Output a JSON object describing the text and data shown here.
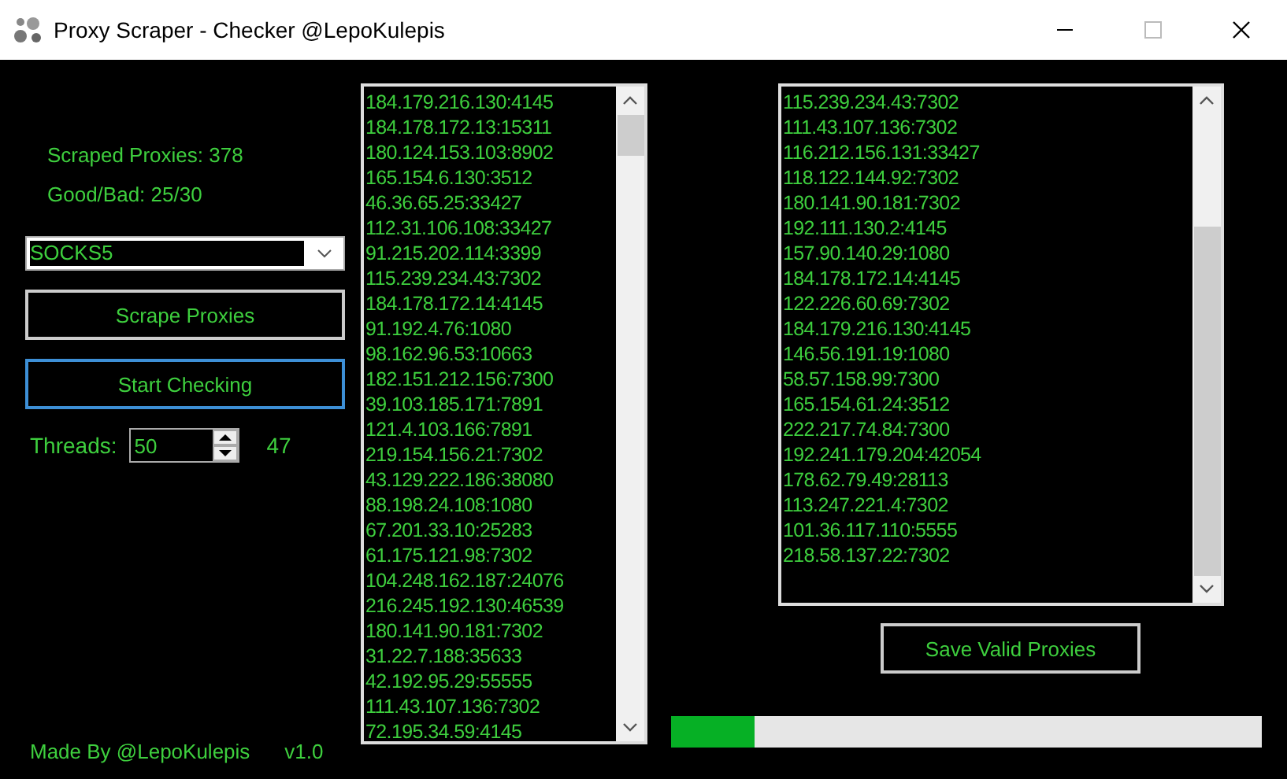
{
  "window": {
    "title": "Proxy Scraper - Checker @LepoKulepis"
  },
  "stats": [
    "Scraped Proxies: 378",
    "Good/Bad: 25/30"
  ],
  "proxy_type": {
    "value": "SOCKS5"
  },
  "buttons": [
    {
      "label": "Scrape Proxies",
      "focused": false
    },
    {
      "label": "Start Checking",
      "focused": true
    }
  ],
  "threads": {
    "label": "Threads:",
    "value": "50",
    "count": "47"
  },
  "scraped_list": [
    "184.179.216.130:4145",
    "184.178.172.13:15311",
    "180.124.153.103:8902",
    "165.154.6.130:3512",
    "46.36.65.25:33427",
    "112.31.106.108:33427",
    "91.215.202.114:3399",
    "115.239.234.43:7302",
    "184.178.172.14:4145",
    "91.192.4.76:1080",
    "98.162.96.53:10663",
    "182.151.212.156:7300",
    "39.103.185.171:7891",
    "121.4.103.166:7891",
    "219.154.156.21:7302",
    "43.129.222.186:38080",
    "88.198.24.108:1080",
    "67.201.33.10:25283",
    "61.175.121.98:7302",
    "104.248.162.187:24076",
    "216.245.192.130:46539",
    "180.141.90.181:7302",
    "31.22.7.188:35633",
    "42.192.95.29:55555",
    "111.43.107.136:7302",
    "72.195.34.59:4145"
  ],
  "valid_list": [
    "115.239.234.43:7302",
    "111.43.107.136:7302",
    "116.212.156.131:33427",
    "118.122.144.92:7302",
    "180.141.90.181:7302",
    "192.111.130.2:4145",
    "157.90.140.29:1080",
    "184.178.172.14:4145",
    "122.226.60.69:7302",
    "184.179.216.130:4145",
    "146.56.191.19:1080",
    "58.57.158.99:7300",
    "165.154.61.24:3512",
    "222.217.74.84:7300",
    "192.241.179.204:42054",
    "178.62.79.49:28113",
    "113.247.221.4:7302",
    "101.36.117.110:5555",
    "218.58.137.22:7302"
  ],
  "save_button": {
    "label": "Save Valid Proxies"
  },
  "progress": {
    "level": 0.14
  },
  "footer": {
    "credit": "Made By @LepoKulepis",
    "version": "v1.0"
  }
}
